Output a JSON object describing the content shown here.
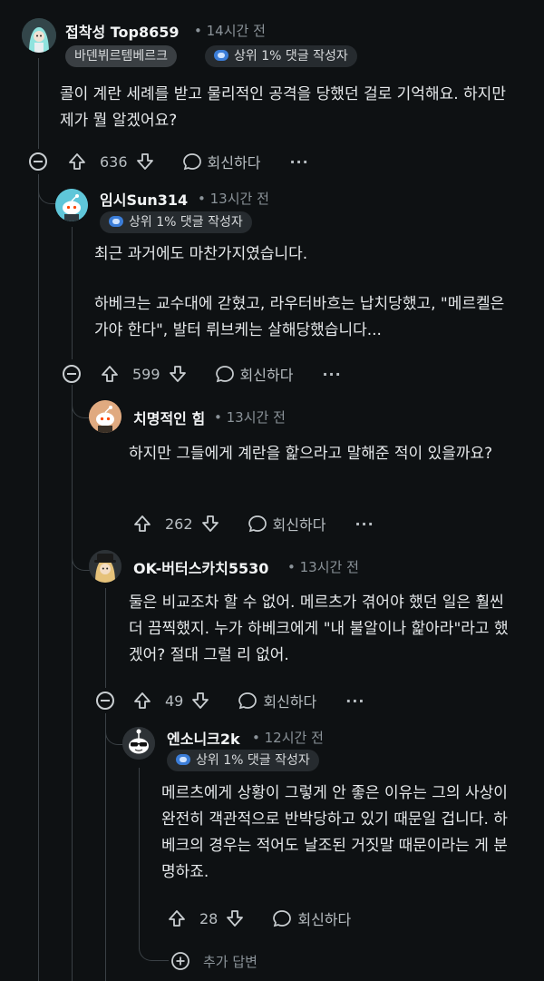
{
  "comments": [
    {
      "username": "접착성 Top8659",
      "time": "14시간 전",
      "flair": "바덴뷔르템베르크",
      "badge": "상위 1% 댓글 작성자",
      "body": [
        "콜이 계란 세례를 받고 물리적인 공격을 당했던 걸로 기억해요. 하지만 제가 뭘 알겠어요?"
      ],
      "votes": "636",
      "reply_label": "회신하다",
      "more": "···"
    },
    {
      "username": "임시Sun314",
      "time": "13시간 전",
      "badge": "상위 1% 댓글 작성자",
      "body": [
        "최근 과거에도 마찬가지였습니다.",
        "하베크는 교수대에 갇혔고, 라우터바흐는 납치당했고, \"메르켈은 가야 한다\", 발터 뤼브케는 살해당했습니다..."
      ],
      "votes": "599",
      "reply_label": "회신하다",
      "more": "···"
    },
    {
      "username": "치명적인 힘",
      "time": "13시간 전",
      "body": [
        "하지만 그들에게 계란을 핥으라고 말해준 적이 있을까요?"
      ],
      "votes": "262",
      "reply_label": "회신하다",
      "more": "···"
    },
    {
      "username": "OK-버터스카치5530",
      "time": "13시간 전",
      "body": [
        "둘은 비교조차 할 수 없어. 메르츠가 겪어야 했던 일은 훨씬 더 끔찍했지. 누가 하베크에게 \"내 불알이나 핥아라\"라고 했겠어? 절대 그럴 리 없어."
      ],
      "votes": "49",
      "reply_label": "회신하다",
      "more": "···"
    },
    {
      "username": "엔소니크2k",
      "time": "12시간 전",
      "badge": "상위 1% 댓글 작성자",
      "body": [
        "메르츠에게 상황이 그렇게 안 좋은 이유는 그의 사상이 완전히 객관적으로 반박당하고 있기 때문일 겁니다. 하베크의 경우는 적어도 날조된 거짓말 때문이라는 게 분명하죠."
      ],
      "votes": "28",
      "reply_label": "회신하다"
    }
  ],
  "more_replies": "추가 답변",
  "colors": {
    "background": "#0e1113",
    "text": "#e6e9eb",
    "muted": "#8b9399",
    "badge_bg": "#262b2f"
  }
}
